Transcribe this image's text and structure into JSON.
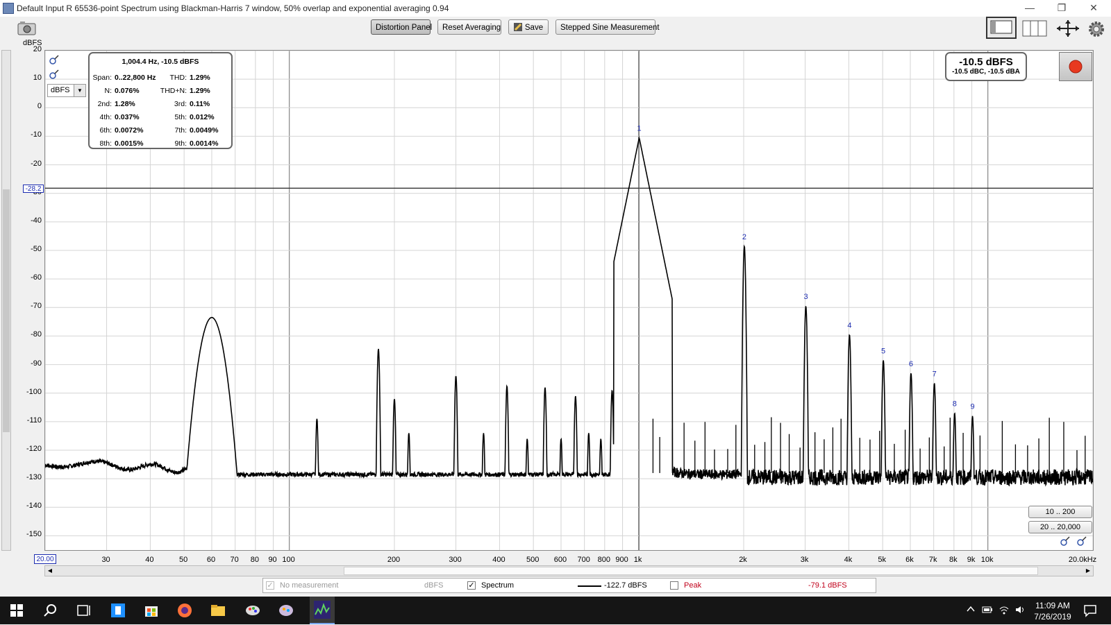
{
  "window": {
    "title": "Default Input R 65536-point Spectrum using Blackman-Harris 7 window, 50% overlap and exponential averaging 0.94",
    "minimize_glyph": "—",
    "restore_glyph": "❐",
    "close_glyph": "✕"
  },
  "toolbar": {
    "distortion_panel": "Distortion Panel",
    "reset_averaging": "Reset Averaging",
    "save": "Save",
    "stepped_sine": "Stepped Sine Measurement",
    "icons": [
      "camera-icon",
      "layout-icon",
      "columns-icon",
      "fit-arrows-icon",
      "gear-icon"
    ]
  },
  "axes": {
    "y_unit": "dBFS",
    "y_ticks": [
      "20",
      "10",
      "0",
      "-10",
      "-20",
      "-30",
      "-40",
      "-50",
      "-60",
      "-70",
      "-80",
      "-90",
      "-100",
      "-110",
      "-120",
      "-130",
      "-140",
      "-150"
    ],
    "x_ticks": [
      "30",
      "40",
      "50",
      "60",
      "70",
      "80",
      "90",
      "100",
      "200",
      "300",
      "400",
      "500",
      "600",
      "700",
      "800",
      "900",
      "1k",
      "2k",
      "3k",
      "4k",
      "5k",
      "6k",
      "7k",
      "8k",
      "9k",
      "10k",
      "20.0kHz"
    ],
    "x_start": "20.00",
    "cursor_label": "-28.2",
    "unit_select": "dBFS"
  },
  "distortion": {
    "header": "1,004.4 Hz, -10.5 dBFS",
    "rows": [
      {
        "k1": "Span:",
        "v1": "0..22,800 Hz",
        "k2": "THD:",
        "v2": "1.29%"
      },
      {
        "k1": "N:",
        "v1": "0.076%",
        "k2": "THD+N:",
        "v2": "1.29%"
      },
      {
        "k1": "2nd:",
        "v1": "1.28%",
        "k2": "3rd:",
        "v2": "0.11%"
      },
      {
        "k1": "4th:",
        "v1": "0.037%",
        "k2": "5th:",
        "v2": "0.012%"
      },
      {
        "k1": "6th:",
        "v1": "0.0072%",
        "k2": "7th:",
        "v2": "0.0049%"
      },
      {
        "k1": "8th:",
        "v1": "0.0015%",
        "k2": "9th:",
        "v2": "0.0014%"
      }
    ]
  },
  "level": {
    "main": "-10.5 dBFS",
    "sub": "-10.5 dBC, -10.5 dBA"
  },
  "ranges": {
    "low": "10 .. 200",
    "mid": "20 .. 20,000"
  },
  "legend": {
    "no_measurement": "No measurement",
    "no_measurement_unit": "dBFS",
    "spectrum": "Spectrum",
    "spectrum_value": "-122.7 dBFS",
    "peak": "Peak",
    "peak_value": "-79.1 dBFS",
    "check_glyph": "✓"
  },
  "harmonic_labels": [
    "1",
    "2",
    "3",
    "4",
    "5",
    "6",
    "7",
    "8",
    "9"
  ],
  "chart_data": {
    "type": "line",
    "x_scale": "log",
    "xlim": [
      20,
      20000
    ],
    "ylim": [
      -155,
      20
    ],
    "ylabel": "dBFS",
    "grid": true,
    "cursor_level": -28.2,
    "noise_floor": -128,
    "harmonics": [
      {
        "label": "1",
        "freq": 1004.4,
        "level": -10.5
      },
      {
        "label": "2",
        "freq": 2008.8,
        "level": -48.5
      },
      {
        "label": "3",
        "freq": 3013.2,
        "level": -69.5
      },
      {
        "label": "4",
        "freq": 4017.6,
        "level": -79.5
      },
      {
        "label": "5",
        "freq": 5022,
        "level": -88.5
      },
      {
        "label": "6",
        "freq": 6026.4,
        "level": -93
      },
      {
        "label": "7",
        "freq": 7030.8,
        "level": -96.5
      },
      {
        "label": "8",
        "freq": 8035.2,
        "level": -107
      },
      {
        "label": "9",
        "freq": 9039.6,
        "level": -108
      }
    ],
    "other_peaks": [
      {
        "freq": 60,
        "level": -73.5
      },
      {
        "freq": 120,
        "level": -109
      },
      {
        "freq": 180,
        "level": -84.5
      },
      {
        "freq": 200,
        "level": -102
      },
      {
        "freq": 220,
        "level": -114
      },
      {
        "freq": 300,
        "level": -94
      },
      {
        "freq": 360,
        "level": -114
      },
      {
        "freq": 420,
        "level": -97.5
      },
      {
        "freq": 480,
        "level": -116
      },
      {
        "freq": 540,
        "level": -98
      },
      {
        "freq": 600,
        "level": -116
      },
      {
        "freq": 660,
        "level": -101
      },
      {
        "freq": 720,
        "level": -114
      },
      {
        "freq": 780,
        "level": -116
      },
      {
        "freq": 840,
        "level": -99
      },
      {
        "freq": 900,
        "level": -110
      }
    ]
  }
}
